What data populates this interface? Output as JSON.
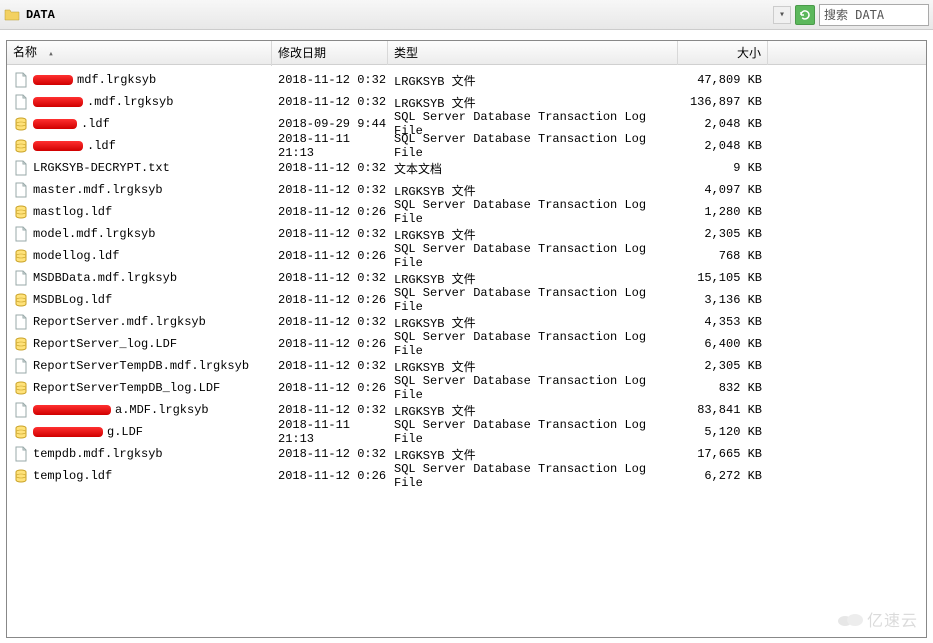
{
  "toolbar": {
    "path": "DATA",
    "search_placeholder": "搜索 DATA"
  },
  "columns": {
    "name": "名称",
    "date": "修改日期",
    "type": "类型",
    "size": "大小"
  },
  "files": [
    {
      "icon": "file",
      "redact_width": 40,
      "name_suffix": " mdf.lrgksyb",
      "date": "2018-11-12 0:32",
      "type": "LRGKSYB 文件",
      "size": "47,809 KB"
    },
    {
      "icon": "file",
      "redact_width": 50,
      "name_suffix": ".mdf.lrgksyb",
      "date": "2018-11-12 0:32",
      "type": "LRGKSYB 文件",
      "size": "136,897 KB"
    },
    {
      "icon": "db",
      "redact_width": 44,
      "name_suffix": ".ldf",
      "date": "2018-09-29 9:44",
      "type": "SQL Server Database Transaction Log File",
      "size": "2,048 KB"
    },
    {
      "icon": "db",
      "redact_width": 50,
      "name_suffix": ".ldf",
      "date": "2018-11-11 21:13",
      "type": "SQL Server Database Transaction Log File",
      "size": "2,048 KB"
    },
    {
      "icon": "file",
      "redact_width": 0,
      "name_suffix": "LRGKSYB-DECRYPT.txt",
      "date": "2018-11-12 0:32",
      "type": "文本文档",
      "size": "9 KB"
    },
    {
      "icon": "file",
      "redact_width": 0,
      "name_suffix": "master.mdf.lrgksyb",
      "date": "2018-11-12 0:32",
      "type": "LRGKSYB 文件",
      "size": "4,097 KB"
    },
    {
      "icon": "db",
      "redact_width": 0,
      "name_suffix": "mastlog.ldf",
      "date": "2018-11-12 0:26",
      "type": "SQL Server Database Transaction Log File",
      "size": "1,280 KB"
    },
    {
      "icon": "file",
      "redact_width": 0,
      "name_suffix": "model.mdf.lrgksyb",
      "date": "2018-11-12 0:32",
      "type": "LRGKSYB 文件",
      "size": "2,305 KB"
    },
    {
      "icon": "db",
      "redact_width": 0,
      "name_suffix": "modellog.ldf",
      "date": "2018-11-12 0:26",
      "type": "SQL Server Database Transaction Log File",
      "size": "768 KB"
    },
    {
      "icon": "file",
      "redact_width": 0,
      "name_suffix": "MSDBData.mdf.lrgksyb",
      "date": "2018-11-12 0:32",
      "type": "LRGKSYB 文件",
      "size": "15,105 KB"
    },
    {
      "icon": "db",
      "redact_width": 0,
      "name_suffix": "MSDBLog.ldf",
      "date": "2018-11-12 0:26",
      "type": "SQL Server Database Transaction Log File",
      "size": "3,136 KB"
    },
    {
      "icon": "file",
      "redact_width": 0,
      "name_suffix": "ReportServer.mdf.lrgksyb",
      "date": "2018-11-12 0:32",
      "type": "LRGKSYB 文件",
      "size": "4,353 KB"
    },
    {
      "icon": "db",
      "redact_width": 0,
      "name_suffix": "ReportServer_log.LDF",
      "date": "2018-11-12 0:26",
      "type": "SQL Server Database Transaction Log File",
      "size": "6,400 KB"
    },
    {
      "icon": "file",
      "redact_width": 0,
      "name_suffix": "ReportServerTempDB.mdf.lrgksyb",
      "date": "2018-11-12 0:32",
      "type": "LRGKSYB 文件",
      "size": "2,305 KB"
    },
    {
      "icon": "db",
      "redact_width": 0,
      "name_suffix": "ReportServerTempDB_log.LDF",
      "date": "2018-11-12 0:26",
      "type": "SQL Server Database Transaction Log File",
      "size": "832 KB"
    },
    {
      "icon": "file",
      "redact_width": 78,
      "name_suffix": "a.MDF.lrgksyb",
      "date": "2018-11-12 0:32",
      "type": "LRGKSYB 文件",
      "size": "83,841 KB"
    },
    {
      "icon": "db",
      "redact_width": 70,
      "name_suffix": "g.LDF",
      "date": "2018-11-11 21:13",
      "type": "SQL Server Database Transaction Log File",
      "size": "5,120 KB"
    },
    {
      "icon": "file",
      "redact_width": 0,
      "name_suffix": "tempdb.mdf.lrgksyb",
      "date": "2018-11-12 0:32",
      "type": "LRGKSYB 文件",
      "size": "17,665 KB"
    },
    {
      "icon": "db",
      "redact_width": 0,
      "name_suffix": "templog.ldf",
      "date": "2018-11-12 0:26",
      "type": "SQL Server Database Transaction Log File",
      "size": "6,272 KB"
    }
  ],
  "watermark": "亿速云"
}
